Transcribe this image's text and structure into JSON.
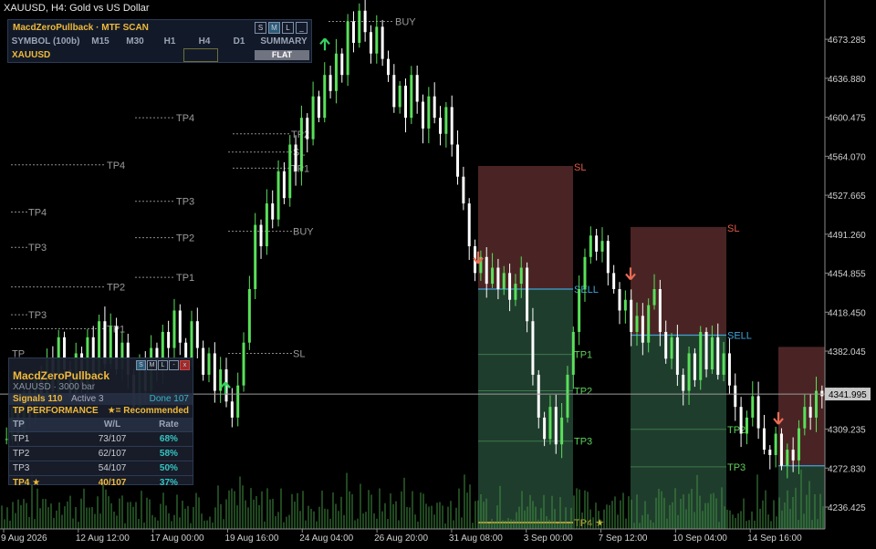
{
  "window": {
    "title": "XAUUSD, H4:  Gold vs US Dollar"
  },
  "mtf_panel": {
    "title": "MacdZeroPullback · MTF SCAN",
    "controls": [
      "S",
      "M",
      "L",
      "_"
    ],
    "headers": [
      "SYMBOL (100b)",
      "M15",
      "M30",
      "H1",
      "H4",
      "D1",
      "SUMMARY"
    ],
    "symbol": "XAUUSD",
    "summary": "FLAT"
  },
  "stats_panel": {
    "title": "MacdZeroPullback",
    "subtitle": "XAUUSD · 3000 bar",
    "controls": [
      "S",
      "M",
      "L",
      "-",
      "x"
    ],
    "signals": "Signals 110",
    "active": "Active 3",
    "done": "Done 107",
    "perf_label": "TP PERFORMANCE",
    "rec_label": "★= Recommended",
    "columns": [
      "TP",
      "W/L",
      "Rate"
    ],
    "rows": [
      {
        "tp": "TP1",
        "wl": "73/107",
        "rate": "68%"
      },
      {
        "tp": "TP2",
        "wl": "62/107",
        "rate": "58%"
      },
      {
        "tp": "TP3",
        "wl": "54/107",
        "rate": "50%"
      },
      {
        "tp": "TP4 ★",
        "wl": "40/107",
        "rate": "37%"
      }
    ]
  },
  "price_axis": {
    "ticks": [
      "4673.285",
      "4636.880",
      "4600.475",
      "4564.070",
      "4527.665",
      "4491.260",
      "4454.855",
      "4418.450",
      "4382.045",
      "4345.640",
      "4309.235",
      "4272.830",
      "4236.425"
    ],
    "current": "4341.995"
  },
  "time_axis": {
    "ticks": [
      "9 Aug 2026",
      "12 Aug 12:00",
      "17 Aug 00:00",
      "19 Aug 16:00",
      "24 Aug 04:00",
      "26 Aug 20:00",
      "31 Aug 08:00",
      "3 Sep 00:00",
      "7 Sep 12:00",
      "10 Sep 04:00",
      "14 Sep 16:00"
    ]
  },
  "chart_data": {
    "type": "candlestick",
    "symbol": "XAUUSD",
    "timeframe": "H4",
    "ylim": [
      4216,
      4710
    ],
    "current_price": 4341.995,
    "price_path": [
      4300,
      4330,
      4305,
      4345,
      4320,
      4360,
      4335,
      4375,
      4345,
      4395,
      4365,
      4340,
      4380,
      4350,
      4395,
      4360,
      4410,
      4370,
      4405,
      4365,
      4390,
      4360,
      4330,
      4370,
      4345,
      4385,
      4365,
      4400,
      4385,
      4420,
      4390,
      4375,
      4410,
      4385,
      4360,
      4380,
      4345,
      4365,
      4335,
      4320,
      4350,
      4390,
      4440,
      4500,
      4480,
      4520,
      4505,
      4550,
      4525,
      4575,
      4550,
      4600,
      4580,
      4620,
      4600,
      4640,
      4625,
      4660,
      4640,
      4690,
      4670,
      4700,
      4680,
      4660,
      4685,
      4655,
      4640,
      4610,
      4630,
      4600,
      4640,
      4615,
      4590,
      4620,
      4600,
      4585,
      4610,
      4575,
      4545,
      4520,
      4480,
      4455,
      4470,
      4445,
      4460,
      4440,
      4455,
      4430,
      4445,
      4460,
      4410,
      4360,
      4320,
      4300,
      4330,
      4295,
      4320,
      4360,
      4400,
      4440,
      4470,
      4490,
      4475,
      4485,
      4455,
      4440,
      4420,
      4430,
      4400,
      4415,
      4390,
      4425,
      4440,
      4400,
      4375,
      4395,
      4360,
      4345,
      4380,
      4355,
      4400,
      4365,
      4395,
      4360,
      4380,
      4350,
      4330,
      4305,
      4320,
      4340,
      4310,
      4290,
      4285,
      4305,
      4275,
      4290,
      4280,
      4310,
      4330,
      4320,
      4345,
      4340
    ]
  },
  "trade_zones": [
    {
      "entry_label": "SELL",
      "sl_label": "SL",
      "entry": 4440,
      "sl": 4555,
      "tps": [
        {
          "label": "TP1",
          "price": 4379
        },
        {
          "label": "TP2",
          "price": 4345
        },
        {
          "label": "TP3",
          "price": 4298
        },
        {
          "label": "TP4 ★",
          "price": 4222
        }
      ]
    },
    {
      "entry_label": "SELL",
      "sl_label": "SL",
      "entry": 4397,
      "sl": 4498,
      "tps": [
        {
          "label": "TP2",
          "price": 4309
        },
        {
          "label": "TP3",
          "price": 4274
        }
      ]
    },
    {
      "entry_label": "",
      "sl_label": "",
      "entry": 4275,
      "sl": 4386,
      "tps": []
    }
  ],
  "old_levels": [
    {
      "label": "BUY",
      "price": 4690
    },
    {
      "label": "SL",
      "price": 4568
    },
    {
      "label": "TP4",
      "price": 4600
    },
    {
      "label": "TP2",
      "price": 4585
    },
    {
      "label": "TP1",
      "price": 4553
    },
    {
      "label": "TP4",
      "price": 4556
    },
    {
      "label": "TP3",
      "price": 4522
    },
    {
      "label": "BUY",
      "price": 4494
    },
    {
      "label": "TP2",
      "price": 4488
    },
    {
      "label": "TP1",
      "price": 4451
    },
    {
      "label": "TP4",
      "price": 4512
    },
    {
      "label": "TP3",
      "price": 4479
    },
    {
      "label": "TP2",
      "price": 4442
    },
    {
      "label": "TP3",
      "price": 4416
    },
    {
      "label": "TP1",
      "price": 4403
    },
    {
      "label": "SL",
      "price": 4380
    },
    {
      "label": "TP",
      "price": 4380
    }
  ],
  "signals": [
    {
      "dir": "up"
    },
    {
      "dir": "up"
    },
    {
      "dir": "down"
    },
    {
      "dir": "down"
    },
    {
      "dir": "down"
    }
  ],
  "colors": {
    "bull": "#59e05a",
    "bear": "#ffffff",
    "sl_zone": "#4a2424",
    "tp_zone": "#1f3d2d",
    "entry": "#3fa3d8",
    "sl_label": "#e05a46",
    "tp_label": "#5bd05a",
    "gold": "#f0b93a",
    "arrow_down": "#ec6b55",
    "arrow_up": "#38d063"
  }
}
